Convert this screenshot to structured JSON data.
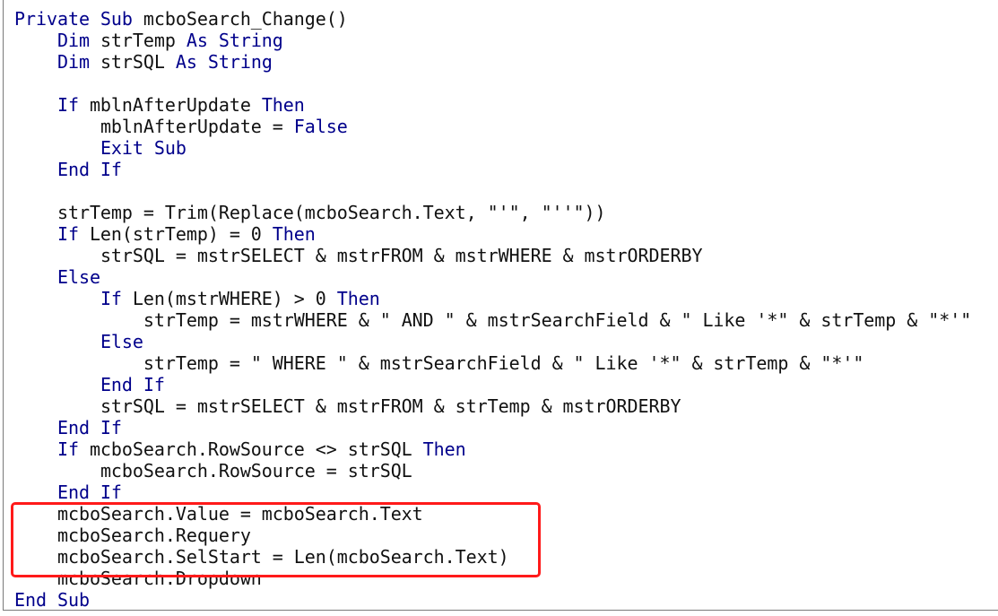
{
  "editor": {
    "language": "VBA",
    "colors": {
      "keyword": "#00008b",
      "text": "#111111",
      "highlight_box": "#ff1a1a"
    },
    "highlighted_lines": [
      23,
      24,
      25
    ],
    "lines": [
      {
        "indent": 0,
        "tokens": [
          {
            "t": "Private Sub",
            "k": true
          },
          {
            "t": " mcboSearch_Change()"
          }
        ]
      },
      {
        "indent": 1,
        "tokens": [
          {
            "t": "Dim",
            "k": true
          },
          {
            "t": " strTemp "
          },
          {
            "t": "As String",
            "k": true
          }
        ]
      },
      {
        "indent": 1,
        "tokens": [
          {
            "t": "Dim",
            "k": true
          },
          {
            "t": " strSQL "
          },
          {
            "t": "As String",
            "k": true
          }
        ]
      },
      {
        "indent": 0,
        "tokens": []
      },
      {
        "indent": 1,
        "tokens": [
          {
            "t": "If",
            "k": true
          },
          {
            "t": " mblnAfterUpdate "
          },
          {
            "t": "Then",
            "k": true
          }
        ]
      },
      {
        "indent": 2,
        "tokens": [
          {
            "t": "mblnAfterUpdate = "
          },
          {
            "t": "False",
            "k": true
          }
        ]
      },
      {
        "indent": 2,
        "tokens": [
          {
            "t": "Exit Sub",
            "k": true
          }
        ]
      },
      {
        "indent": 1,
        "tokens": [
          {
            "t": "End If",
            "k": true
          }
        ]
      },
      {
        "indent": 0,
        "tokens": []
      },
      {
        "indent": 1,
        "tokens": [
          {
            "t": "strTemp = Trim(Replace(mcboSearch.Text, \"'\", \"''\"))"
          }
        ]
      },
      {
        "indent": 1,
        "tokens": [
          {
            "t": "If",
            "k": true
          },
          {
            "t": " Len(strTemp) = 0 "
          },
          {
            "t": "Then",
            "k": true
          }
        ]
      },
      {
        "indent": 2,
        "tokens": [
          {
            "t": "strSQL = mstrSELECT & mstrFROM & mstrWHERE & mstrORDERBY"
          }
        ]
      },
      {
        "indent": 1,
        "tokens": [
          {
            "t": "Else",
            "k": true
          }
        ]
      },
      {
        "indent": 2,
        "tokens": [
          {
            "t": "If",
            "k": true
          },
          {
            "t": " Len(mstrWHERE) > 0 "
          },
          {
            "t": "Then",
            "k": true
          }
        ]
      },
      {
        "indent": 3,
        "tokens": [
          {
            "t": "strTemp = mstrWHERE & \" AND \" & mstrSearchField & \" Like '*\" & strTemp & \"*'\""
          }
        ]
      },
      {
        "indent": 2,
        "tokens": [
          {
            "t": "Else",
            "k": true
          }
        ]
      },
      {
        "indent": 3,
        "tokens": [
          {
            "t": "strTemp = \" WHERE \" & mstrSearchField & \" Like '*\" & strTemp & \"*'\""
          }
        ]
      },
      {
        "indent": 2,
        "tokens": [
          {
            "t": "End If",
            "k": true
          }
        ]
      },
      {
        "indent": 2,
        "tokens": [
          {
            "t": "strSQL = mstrSELECT & mstrFROM & strTemp & mstrORDERBY"
          }
        ]
      },
      {
        "indent": 1,
        "tokens": [
          {
            "t": "End If",
            "k": true
          }
        ]
      },
      {
        "indent": 1,
        "tokens": [
          {
            "t": "If",
            "k": true
          },
          {
            "t": " mcboSearch.RowSource <> strSQL "
          },
          {
            "t": "Then",
            "k": true
          }
        ]
      },
      {
        "indent": 2,
        "tokens": [
          {
            "t": "mcboSearch.RowSource = strSQL"
          }
        ]
      },
      {
        "indent": 1,
        "tokens": [
          {
            "t": "End If",
            "k": true
          }
        ]
      },
      {
        "indent": 1,
        "tokens": [
          {
            "t": "mcboSearch.Value = mcboSearch.Text"
          }
        ]
      },
      {
        "indent": 1,
        "tokens": [
          {
            "t": "mcboSearch.Requery"
          }
        ]
      },
      {
        "indent": 1,
        "tokens": [
          {
            "t": "mcboSearch.SelStart = Len(mcboSearch.Text)"
          }
        ]
      },
      {
        "indent": 1,
        "tokens": [
          {
            "t": "mcboSearch.Dropdown"
          }
        ]
      },
      {
        "indent": 0,
        "tokens": [
          {
            "t": "End Sub",
            "k": true
          }
        ]
      }
    ]
  }
}
